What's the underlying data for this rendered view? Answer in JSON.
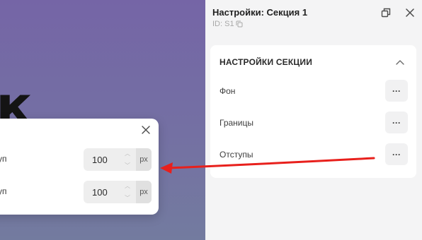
{
  "canvas": {
    "heading_fragment": "к"
  },
  "popup": {
    "rows": [
      {
        "label": "тступ",
        "value": "100",
        "unit": "px"
      },
      {
        "label": "тступ",
        "value": "100",
        "unit": "px"
      }
    ]
  },
  "panel": {
    "title": "Настройки: Секция 1",
    "id_text": "ID: S1",
    "section": {
      "title": "НАСТРОЙКИ СЕКЦИИ",
      "items": [
        {
          "label": "Фон",
          "action": "···"
        },
        {
          "label": "Границы",
          "action": "···"
        },
        {
          "label": "Отступы",
          "action": "···"
        }
      ]
    }
  },
  "colors": {
    "accent_arrow": "#e8201c",
    "canvas_top": "#7565a6",
    "canvas_bottom": "#737b9f",
    "panel_bg": "#f4f4f5"
  },
  "icons": {
    "popup_close": "close-icon",
    "panel_detach": "detach-window-icon",
    "panel_close": "close-icon",
    "copy_id": "copy-icon",
    "collapse": "chevron-up-icon",
    "stepper": "chevron-up-down-icon"
  }
}
